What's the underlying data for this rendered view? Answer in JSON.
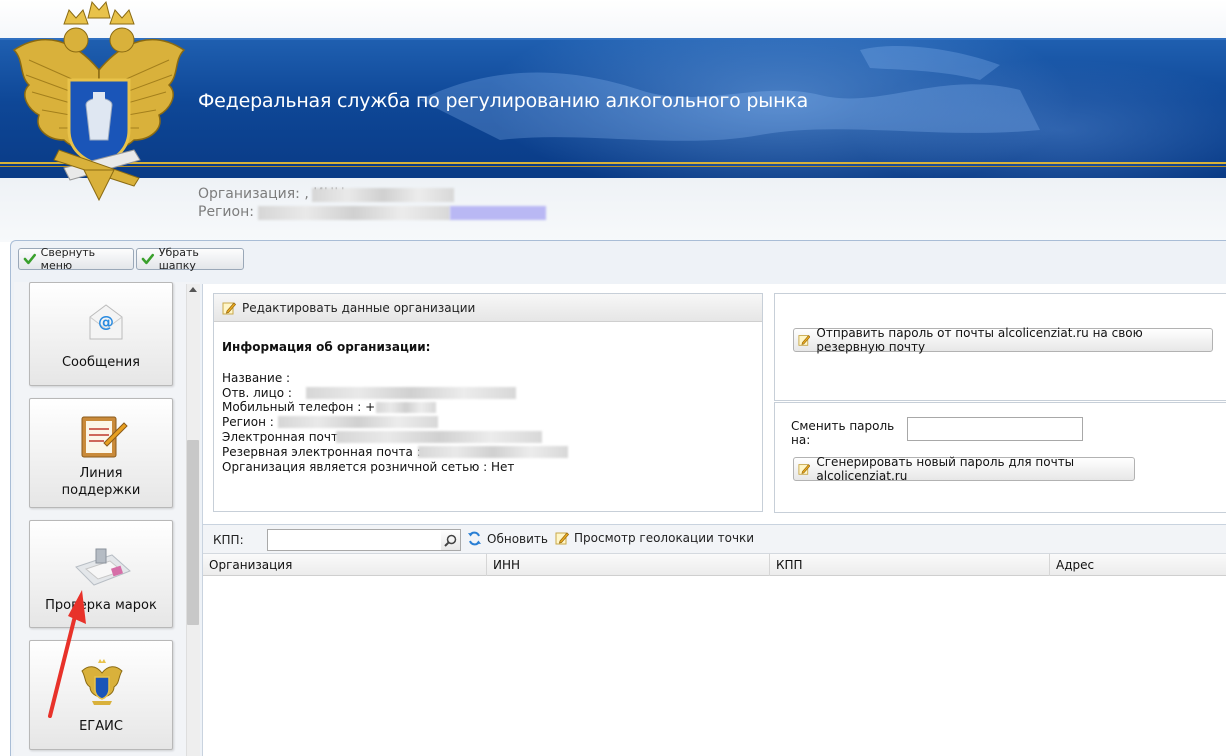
{
  "header": {
    "title": "Федеральная служба по регулированию алкогольного рынка",
    "org_prefix": "Организация: , ИНН: ",
    "region_prefix": "Регион: "
  },
  "toolbar": {
    "collapse_menu": "Свернуть меню",
    "hide_header": "Убрать шапку"
  },
  "sidebar": {
    "items": [
      {
        "label": "Сообщения",
        "icon": "email-icon"
      },
      {
        "label_line1": "Линия",
        "label_line2": "поддержки",
        "icon": "support-clipboard-icon"
      },
      {
        "label": "Проверка марок",
        "icon": "stamp-scanner-icon"
      },
      {
        "label": "ЕГАИС",
        "icon": "emblem-icon"
      }
    ]
  },
  "org_info": {
    "edit_button": "Редактировать данные организации",
    "title": "Информация об организации:",
    "fields": [
      "Название :",
      "Отв. лицо :",
      "Мобильный телефон : +",
      "Регион :",
      "Электронная почта :",
      "Резервная электронная почта :",
      "Организация является розничной сетью : Нет"
    ]
  },
  "password": {
    "send_button": "Отправить пароль от почты alcolicenziat.ru на свою резервную почту",
    "change_label_line1": "Сменить пароль",
    "change_label_line2": "на:",
    "new_password_value": "",
    "generate_button": "Сгенерировать новый пароль для почты alcolicenziat.ru"
  },
  "grid": {
    "kpp_label": "КПП:",
    "kpp_value": "",
    "refresh": "Обновить",
    "geo_view": "Просмотр геолокации точки",
    "columns": [
      "Организация",
      "ИНН",
      "КПП",
      "Адрес"
    ]
  },
  "colors": {
    "header_blue": "#0e4797",
    "accent_gold": "#d8b23a",
    "annotation_arrow": "#e8322a"
  }
}
